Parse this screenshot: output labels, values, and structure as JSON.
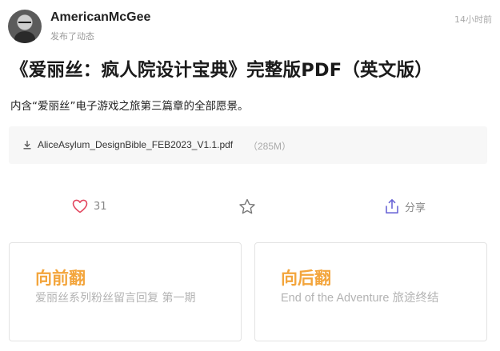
{
  "post": {
    "author": "AmericanMcGee",
    "action": "发布了动态",
    "time": "14小时前",
    "title": "《爱丽丝：疯人院设计宝典》完整版PDF（英文版）",
    "description": "内含“爱丽丝”电子游戏之旅第三篇章的全部愿景。"
  },
  "attachment": {
    "icon": "download-icon",
    "file_name": "AliceAsylum_DesignBible_FEB2023_V1.1.pdf",
    "file_size": "（285M）"
  },
  "actions": {
    "like_icon": "heart-icon",
    "like_count": "31",
    "favorite_icon": "star-icon",
    "share_icon": "share-icon",
    "share_label": "分享"
  },
  "navigation": {
    "prev": {
      "heading": "向前翻",
      "title": "爱丽丝系列粉丝留言回复 第一期"
    },
    "next": {
      "heading": "向后翻",
      "title": "End of the Adventure 旅途终结"
    }
  },
  "colors": {
    "accent": "#f3a53c",
    "like": "#e2455e",
    "share": "#6b66d6"
  }
}
